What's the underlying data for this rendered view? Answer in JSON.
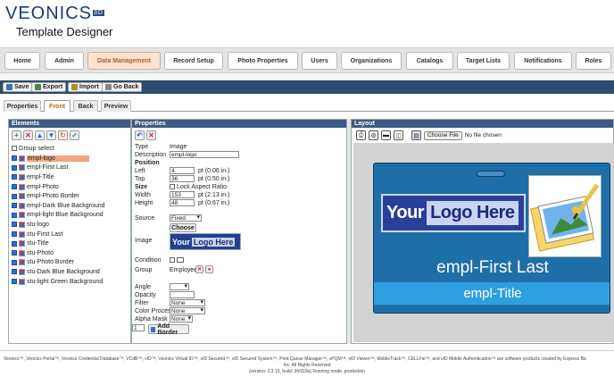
{
  "brand": {
    "logo": "VEONICS",
    "logo_mark": "3D",
    "subtitle": "Template Designer"
  },
  "nav": [
    {
      "label": "Home"
    },
    {
      "label": "Admin"
    },
    {
      "label": "Data Management",
      "active": true
    },
    {
      "label": "Record Setup"
    },
    {
      "label": "Photo Properties"
    },
    {
      "label": "Users"
    },
    {
      "label": "Organizations"
    },
    {
      "label": "Catalogs"
    },
    {
      "label": "Target Lists"
    },
    {
      "label": "Notifications"
    },
    {
      "label": "Roles"
    }
  ],
  "toolbar": {
    "save": "Save",
    "export": "Export",
    "import": "Import",
    "go_back": "Go Back"
  },
  "tabs": [
    {
      "label": "Properties"
    },
    {
      "label": "Front",
      "active": true
    },
    {
      "label": "Back"
    },
    {
      "label": "Preview"
    }
  ],
  "elements": {
    "title": "Elements",
    "group_select": "Group select",
    "items": [
      "empl-logo",
      "empl-First Last",
      "empl-Title",
      "empl-Photo",
      "empl-Photo Border",
      "empl-Dark Blue Background",
      "empl-light Blue Background",
      "stu-logo",
      "stu-First Last",
      "stu-Title",
      "stu-Photo",
      "stu-Photo Border",
      "stu-Dark Blue Background",
      "stu-light Green Background"
    ]
  },
  "properties": {
    "title": "Properties",
    "type_label": "Type",
    "type_value": "Image",
    "description_label": "Description",
    "description_value": "empl-logo",
    "position_label": "Position",
    "left_label": "Left",
    "left_value": "4",
    "left_unit": "pt (0.06 in.)",
    "top_label": "Top",
    "top_value": "36",
    "top_unit": "pt (0.50 in.)",
    "size_label": "Size",
    "lock_label": "Lock Aspect Ratio",
    "width_label": "Width",
    "width_value": "153",
    "width_unit": "pt (2.13 in.)",
    "height_label": "Height",
    "height_value": "48",
    "height_unit": "pt (0.67 in.)",
    "source_label": "Source",
    "source_value": "Fixed",
    "choose": "Choose",
    "image_label": "Image",
    "condition_label": "Condition",
    "group_label": "Group",
    "group_value": "Employee",
    "angle_label": "Angle",
    "opacity_label": "Opacity",
    "filter_label": "Filter",
    "filter_value": "None",
    "color_process_label": "Color Process",
    "color_process_value": "None",
    "alpha_mask_label": "Alpha Mask",
    "alpha_mask_value": "None",
    "border_count": "1",
    "add_border": "Add Border"
  },
  "layout": {
    "title": "Layout",
    "choose_file": "Choose File",
    "no_file": "No file chosen"
  },
  "badge": {
    "logo_your": "Your",
    "logo_logo": "Logo",
    "logo_here": "Here",
    "name": "empl-First Last",
    "title": "empl-Title"
  },
  "footer": {
    "line1": "Veonics™, Veonics Portal™, Veonics Credential Database™, VCdB™, vID™, Veonics Virtual ID™, vID Secured™, vID Secured System™, Print Queue Manager™, vPQM™, vID Viewer™, MobileTrack™, CELLFie™, and vID Mobile Authentication™ are software products created by Express Ba",
    "line2": "Inc. All Rights Reserved",
    "line3": "(version: 2.3.15, build: 3fc919a) Running mode: production"
  },
  "colors": {
    "toolbar": "#2e4c70",
    "panel_header": "#3b5b85",
    "badge_bg": "#1e6fa8",
    "badge_title_bg": "#2f9fe0",
    "active_tab": "#c05a20"
  }
}
